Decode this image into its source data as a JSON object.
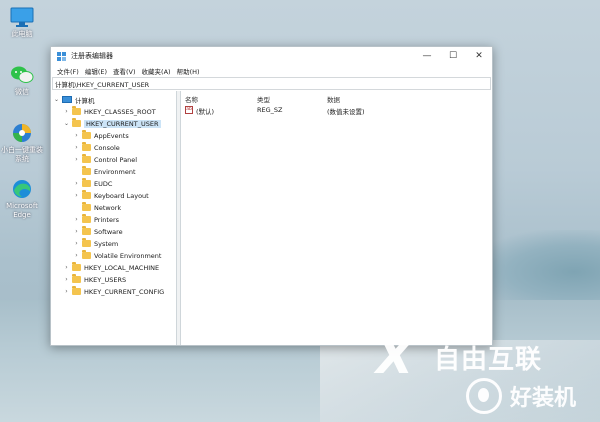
{
  "desktop": {
    "icons": [
      {
        "label": "此电脑",
        "icon": "monitor-icon"
      },
      {
        "label": "微信",
        "icon": "wechat-icon"
      },
      {
        "label": "小白一键重装系统",
        "icon": "xiaobai-icon"
      },
      {
        "label": "Microsoft Edge",
        "icon": "edge-icon"
      }
    ]
  },
  "window": {
    "title": "注册表编辑器",
    "controls": {
      "minimize": "—",
      "maximize": "☐",
      "close": "✕"
    },
    "menu": [
      "文件(F)",
      "编辑(E)",
      "查看(V)",
      "收藏夹(A)",
      "帮助(H)"
    ],
    "address": "计算机\\HKEY_CURRENT_USER",
    "tree": {
      "root": "计算机",
      "hives": [
        "HKEY_CLASSES_ROOT",
        "HKEY_CURRENT_USER",
        "HKEY_LOCAL_MACHINE",
        "HKEY_USERS",
        "HKEY_CURRENT_CONFIG"
      ],
      "current_user_children": [
        "AppEvents",
        "Console",
        "Control Panel",
        "Environment",
        "EUDC",
        "Keyboard Layout",
        "Network",
        "Printers",
        "Software",
        "System",
        "Volatile Environment"
      ],
      "selected": "HKEY_CURRENT_USER"
    },
    "list": {
      "columns": [
        "名称",
        "类型",
        "数据"
      ],
      "rows": [
        {
          "name": "(默认)",
          "type": "REG_SZ",
          "data": "(数值未设置)",
          "icon_text": "ab"
        }
      ]
    }
  },
  "watermark": {
    "top_text": "自由互联",
    "top_mark": "X",
    "bottom_text": "好装机"
  },
  "colors": {
    "accent": "#cce4f7",
    "folder": "#f4c44e",
    "computer": "#3a8fd8"
  }
}
